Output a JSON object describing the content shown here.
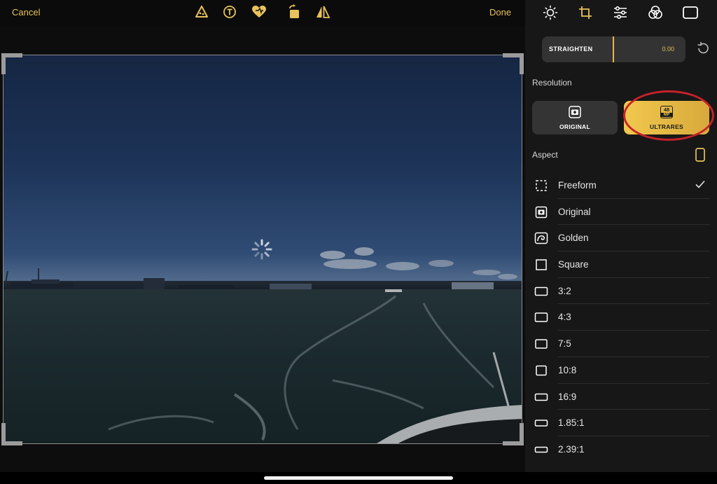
{
  "topbar": {
    "cancel_label": "Cancel",
    "done_label": "Done",
    "tools": [
      "magic-wand-icon",
      "text-icon",
      "heart-icon",
      "rotate-icon",
      "flip-icon"
    ]
  },
  "panel": {
    "tabs": [
      "adjust-light-icon",
      "crop-rotate-icon",
      "sliders-icon",
      "color-circles-icon",
      "frame-icon"
    ],
    "straighten": {
      "label": "STRAIGHTEN",
      "value": "0.00"
    },
    "resolution": {
      "title": "Resolution",
      "original_label": "ORIGINAL",
      "ultrares_label": "ULTRARES",
      "ultrares_badge_top": "48",
      "ultrares_badge_bottom": "MP",
      "selected": "ULTRARES"
    },
    "aspect": {
      "title": "Aspect",
      "items": [
        {
          "label": "Freeform",
          "icon": "freeform-icon",
          "selected": true
        },
        {
          "label": "Original",
          "icon": "original-photo-icon",
          "selected": false
        },
        {
          "label": "Golden",
          "icon": "golden-spiral-icon",
          "selected": false
        },
        {
          "label": "Square",
          "icon": "square-icon",
          "selected": false
        },
        {
          "label": "3:2",
          "icon": "ratio-3-2-icon",
          "selected": false
        },
        {
          "label": "4:3",
          "icon": "ratio-4-3-icon",
          "selected": false
        },
        {
          "label": "7:5",
          "icon": "ratio-7-5-icon",
          "selected": false
        },
        {
          "label": "10:8",
          "icon": "ratio-10-8-icon",
          "selected": false
        },
        {
          "label": "16:9",
          "icon": "ratio-16-9-icon",
          "selected": false
        },
        {
          "label": "1.85:1",
          "icon": "ratio-1-85-icon",
          "selected": false
        },
        {
          "label": "2.39:1",
          "icon": "ratio-2-39-icon",
          "selected": false
        }
      ]
    }
  },
  "colors": {
    "accent": "#e8c25a",
    "highlight_ring": "#c7212a",
    "panel_bg": "#171717"
  }
}
